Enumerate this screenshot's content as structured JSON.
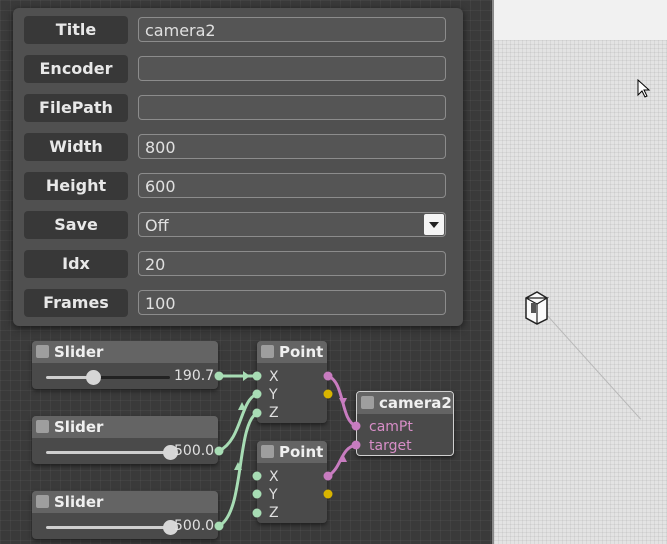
{
  "inspector": {
    "rows": [
      {
        "label": "Title",
        "value": "camera2"
      },
      {
        "label": "Encoder",
        "value": ""
      },
      {
        "label": "FilePath",
        "value": ""
      },
      {
        "label": "Width",
        "value": "800"
      },
      {
        "label": "Height",
        "value": "600"
      },
      {
        "label": "Save",
        "value": "Off"
      },
      {
        "label": "Idx",
        "value": "20"
      },
      {
        "label": "Frames",
        "value": "100"
      }
    ]
  },
  "nodes": {
    "slider1": {
      "title": "Slider",
      "value": "190.7",
      "level": 0.38
    },
    "slider2": {
      "title": "Slider",
      "value": "500.0",
      "level": 1.0
    },
    "slider3": {
      "title": "Slider",
      "value": "500.0",
      "level": 1.0
    },
    "point1": {
      "title": "Point",
      "inputs": [
        "X",
        "Y",
        "Z"
      ]
    },
    "point2": {
      "title": "Point",
      "inputs": [
        "X",
        "Y",
        "Z"
      ]
    },
    "camera": {
      "title": "camera2",
      "inputs": [
        "camPt",
        "target"
      ]
    }
  },
  "colors": {
    "wire_green": "#a8ddb5",
    "wire_pink": "#c87cc0",
    "port_yellow": "#d8b400"
  },
  "icons": [
    "mouse-cursor-icon",
    "camera-object-icon",
    "chevron-down-icon"
  ]
}
